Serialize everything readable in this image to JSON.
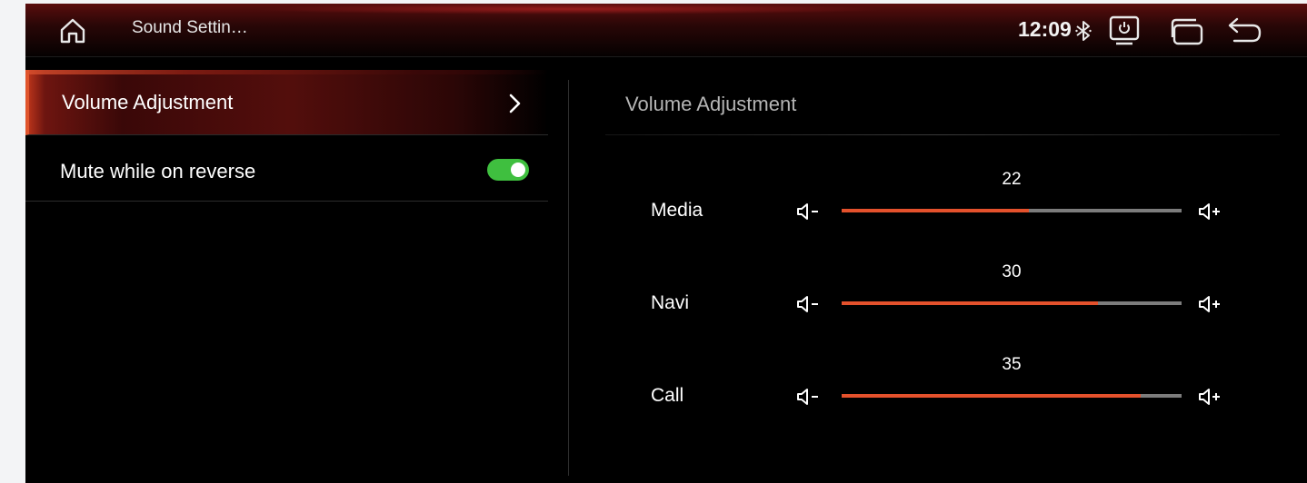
{
  "header": {
    "title": "Sound Settin…",
    "time": "12:09",
    "icons": [
      "home-icon",
      "bluetooth-icon",
      "screen-power-icon",
      "windows-icon",
      "back-icon"
    ]
  },
  "menu": {
    "items": [
      {
        "label": "Volume Adjustment",
        "selected": true,
        "icon": "chevron-right-icon"
      },
      {
        "label": "Mute while on reverse",
        "toggle": true
      }
    ]
  },
  "panel": {
    "title": "Volume Adjustment",
    "sliders": [
      {
        "label": "Media",
        "value": "22",
        "level": 0.55
      },
      {
        "label": "Navi",
        "value": "30",
        "level": 0.755
      },
      {
        "label": "Call",
        "value": "35",
        "level": 0.88
      }
    ]
  },
  "colors": {
    "accent": "#e4512c",
    "toggle_on": "#3fbf3f",
    "track": "#7c7c7c"
  }
}
